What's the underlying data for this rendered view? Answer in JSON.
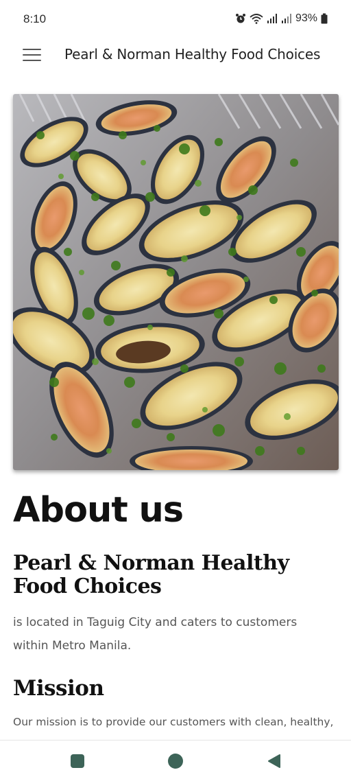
{
  "status_bar": {
    "time": "8:10",
    "battery": "93%",
    "icons": [
      "alarm-icon",
      "wifi-icon",
      "signal-icon",
      "signal-icon-2",
      "battery-icon"
    ]
  },
  "app_bar": {
    "title": "Pearl & Norman Healthy Food Choices",
    "menu_icon": "hamburger-menu-icon"
  },
  "hero_image": {
    "subject": "baked mussels with cheese and parsley in a foil tray"
  },
  "about": {
    "title": "About us",
    "company_name": "Pearl & Norman Healthy Food Choices",
    "location_text": "is located in Taguig City and caters to customers within Metro Manila."
  },
  "mission": {
    "title": "Mission",
    "text": "Our mission is to provide our customers with clean, healthy,"
  },
  "nav_bar": {
    "icons": [
      "recent-apps-icon",
      "home-icon",
      "back-icon"
    ],
    "color": "#3d6458"
  }
}
